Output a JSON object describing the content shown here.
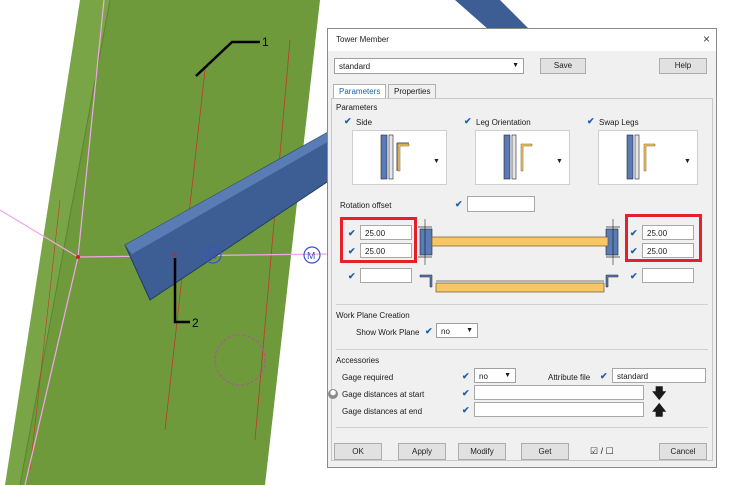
{
  "viewport": {
    "callout_1": "1",
    "callout_2": "2"
  },
  "dialog": {
    "title": "Tower Member",
    "close_glyph": "×",
    "preset_value": "standard",
    "save_label": "Save",
    "help_label": "Help",
    "tabs": [
      "Parameters",
      "Properties"
    ],
    "section_parameters": "Parameters",
    "side_label": "Side",
    "leg_orientation_label": "Leg Orientation",
    "swap_legs_label": "Swap Legs",
    "rotation_offset_label": "Rotation offset",
    "offset_left_top": "25.00",
    "offset_left_bottom": "25.00",
    "offset_right_top": "25.00",
    "offset_right_bottom": "25.00",
    "work_plane_section": "Work Plane Creation",
    "show_work_plane_label": "Show Work Plane",
    "show_work_plane_value": "no",
    "accessories_section": "Accessories",
    "gage_required_label": "Gage required",
    "gage_required_value": "no",
    "attribute_file_label": "Attribute file",
    "attribute_file_value": "standard",
    "gage_start_label": "Gage distances at start",
    "gage_end_label": "Gage distances at end",
    "ok_label": "OK",
    "apply_label": "Apply",
    "modify_label": "Modify",
    "get_label": "Get",
    "toggle_label": "☑ / ☐",
    "cancel_label": "Cancel"
  },
  "colors": {
    "member_green": "#6e9a3c",
    "beam_blue": "#3d5e95",
    "accent_blue": "#1e5faa",
    "highlight_red": "#e5202a",
    "plate_yellow": "#f6c667"
  }
}
